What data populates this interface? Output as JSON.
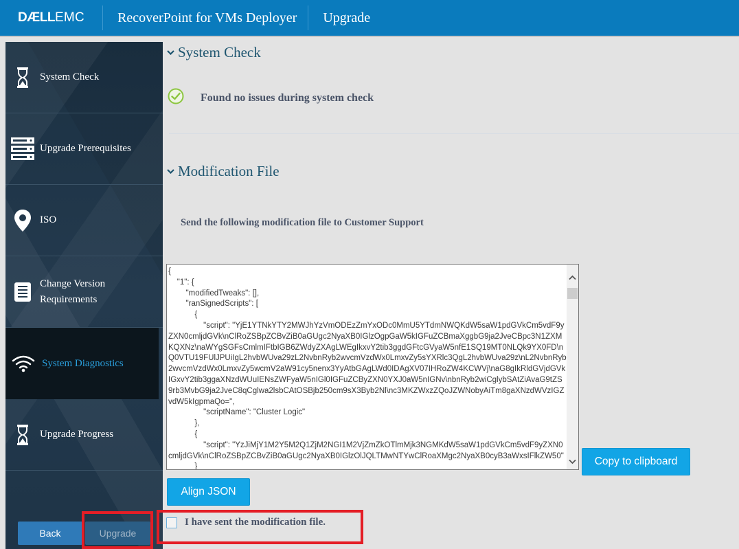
{
  "header": {
    "brand_bold": "DÆLL",
    "brand_light": "EMC",
    "app_title": "RecoverPoint for VMs Deployer",
    "page_title": "Upgrade"
  },
  "sidebar": {
    "items": [
      {
        "label": "System Check",
        "icon": "hourglass-icon"
      },
      {
        "label": "Upgrade Prerequisites",
        "icon": "server-stack-icon"
      },
      {
        "label": "ISO",
        "icon": "map-pin-icon"
      },
      {
        "label_line1": "Change Version",
        "label_line2": "Requirements",
        "icon": "document-list-icon"
      },
      {
        "label": "System Diagnostics",
        "icon": "wifi-icon",
        "active": true
      },
      {
        "label": "Upgrade Progress",
        "icon": "hourglass-icon"
      }
    ],
    "back_label": "Back",
    "upgrade_label": "Upgrade"
  },
  "main": {
    "system_check": {
      "title": "System Check",
      "status_text": "Found no issues during system check"
    },
    "modification_file": {
      "title": "Modification File",
      "instruction": "Send the following modification file to Customer Support",
      "json_content": "{\n    \"1\": {\n        \"modifiedTweaks\": [],\n        \"ranSignedScripts\": [\n            {\n                \"script\": \"YjE1YTNkYTY2MWJhYzVmODEzZmYxODc0MmU5YTdmNWQKdW5saW1pdGVkCm5vdF9yZXN0cmljdGVk\\nClRoZSBpZCBvZiB0aGUgc2NyaXB0IGlzOgpGaW5kIGFuZCBmaXggbG9ja2JveCBpc3N1ZXMKQXNz\\naWYgSGFsCmlmIFtbIGB6ZWdyZXAgLWEgIkxvY2tib3ggdGFtcGVyaW5nfE1SQ19MT0NLQk9YX0FD\\nQ0VTU19FUlJPUiIgL2hvbWUva29zL2NvbnRyb2wvcmVzdWx0LmxvZy5sYXRlc3QgL2hvbWUva29z\\nL2NvbnRyb2wvcmVzdWx0LmxvZy5wcmV2aW91cy5nenx3YyAtbGAgLWd0IDAgXV07IHRoZW4KCWVj\\naG8gIkRldGVjdGVkIGxvY2tib3ggaXNzdWUuIENsZWFyaW5nIGl0IGFuZCByZXN0YXJ0aW5nIGNv\\nbnRyb2wiCglybSAtZiAvaG9tZS9rb3MvbG9ja2JveC8qCglwa2lsbCAtOSBjb250cm9sX3Byb2Nl\\nc3MKZWxzZQoJZWNobyAiTm8gaXNzdWVzIGZvdW5kIgpmaQo=\",\n                \"scriptName\": \"Cluster Logic\"\n            },\n            {\n                \"script\": \"YzJiMjY1M2Y5M2Q1ZjM2NGI1M2VjZmZkOTlmMjk3NGMKdW5saW1pdGVkCm5vdF9yZXN0cmljdGVk\\nClRoZSBpZCBvZiB0aGUgc2NyaXB0IGlzOlJQLTMwNTYwClRoaXMgc2NyaXB0cyB3aWxsIFlkZW50\"\n            }\n        ]\n    }\n}",
      "copy_label": "Copy to clipboard",
      "align_label": "Align JSON",
      "confirm_label": "I have sent the modification file.",
      "confirm_checked": false
    }
  },
  "colors": {
    "header_bg": "#0a7bbd",
    "sidebar_bg": "#1f3548",
    "active_item_text": "#2a9fdc",
    "primary_button": "#12a5e6",
    "highlight_border": "#e41e26",
    "success_check": "#8cc63f"
  }
}
